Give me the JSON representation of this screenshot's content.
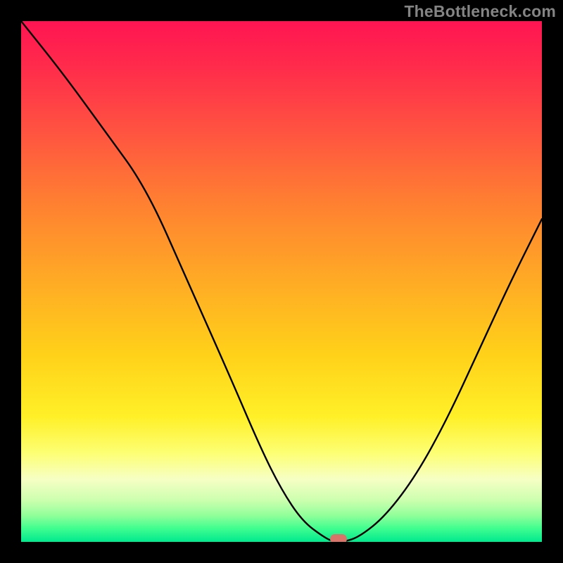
{
  "attribution": "TheBottleneck.com",
  "chart_data": {
    "type": "line",
    "title": "",
    "xlabel": "",
    "ylabel": "",
    "xlim": [
      0,
      100
    ],
    "ylim": [
      0,
      100
    ],
    "x": [
      0,
      8,
      16,
      24,
      32,
      40,
      46,
      50,
      54,
      58,
      60,
      62,
      65,
      70,
      76,
      82,
      88,
      94,
      100
    ],
    "values": [
      100,
      90,
      79,
      68,
      50,
      32,
      18,
      10,
      4,
      1,
      0,
      0,
      1,
      5,
      13,
      24,
      37,
      50,
      62
    ],
    "marker": {
      "x": 61,
      "y": 0
    },
    "gradient_colors": {
      "top": "#ff1452",
      "mid1": "#ffab25",
      "mid2": "#fff028",
      "bottom": "#00e98e"
    }
  }
}
